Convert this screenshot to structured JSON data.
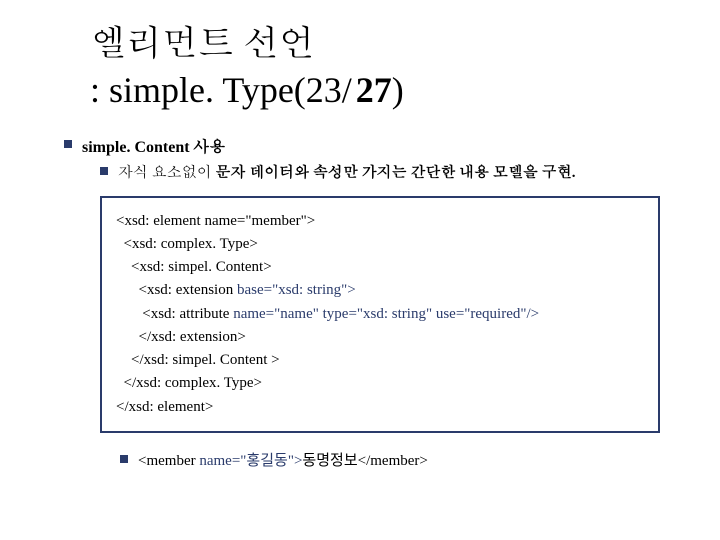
{
  "title": {
    "line1": "엘리먼트 선언",
    "prefix": ": simple. Type(23/",
    "bold": "27",
    "suffix": ")"
  },
  "bullet1": "simple. Content 사용",
  "bullet2_plain1": "자식 요소없이 ",
  "bullet2_nav": "문자 데이터와 속성만 가지는 간단한 내용 모델을 구현.",
  "code": {
    "l1": "<xsd: element name=\"member\">",
    "l2": "  <xsd: complex. Type>",
    "l3": "    <xsd: simpel. Content>",
    "l4_a": "      <xsd: extension ",
    "l4_b": "base=\"xsd: string\">",
    "l5_a": "       <xsd: attribute ",
    "l5_b": "name=\"name\" type=\"xsd: string\" use=\"required\"/>",
    "l6": "      </xsd: extension>",
    "l7": "    </xsd: simpel. Content >",
    "l8": "  </xsd: complex. Type>",
    "l9": "</xsd: element>"
  },
  "example": {
    "a": "<member ",
    "b": "name=\"홍길동\">",
    "c": "동명정보</member>"
  }
}
